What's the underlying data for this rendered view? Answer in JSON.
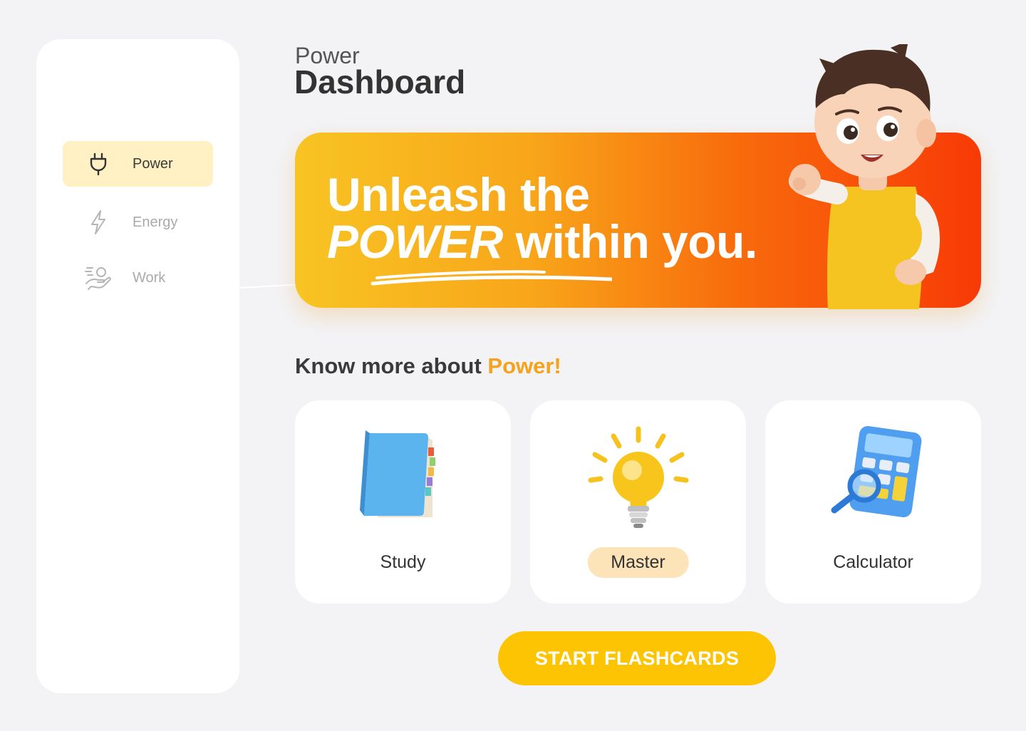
{
  "header": {
    "subtitle": "Power",
    "title": "Dashboard"
  },
  "sidebar": {
    "items": [
      {
        "label": "Power",
        "icon": "plug-icon",
        "active": true
      },
      {
        "label": "Energy",
        "icon": "lightning-icon",
        "active": false
      },
      {
        "label": "Work",
        "icon": "work-hand-icon",
        "active": false
      }
    ]
  },
  "banner": {
    "line1": "Unleash the",
    "line2_emphasis": "POWER",
    "line2_rest": " within you.",
    "gradient_colors": [
      "#f8c423",
      "#f8a51a",
      "#f86a0c",
      "#f83a06"
    ]
  },
  "section": {
    "prefix": "Know more about ",
    "highlight": "Power!",
    "highlight_color": "#f7a21d"
  },
  "cards": [
    {
      "label": "Study",
      "icon": "book-icon",
      "selected": false
    },
    {
      "label": "Master",
      "icon": "lightbulb-icon",
      "selected": true
    },
    {
      "label": "Calculator",
      "icon": "calculator-icon",
      "selected": false
    }
  ],
  "cta": {
    "label": "START FLASHCARDS",
    "color": "#fcc402"
  }
}
